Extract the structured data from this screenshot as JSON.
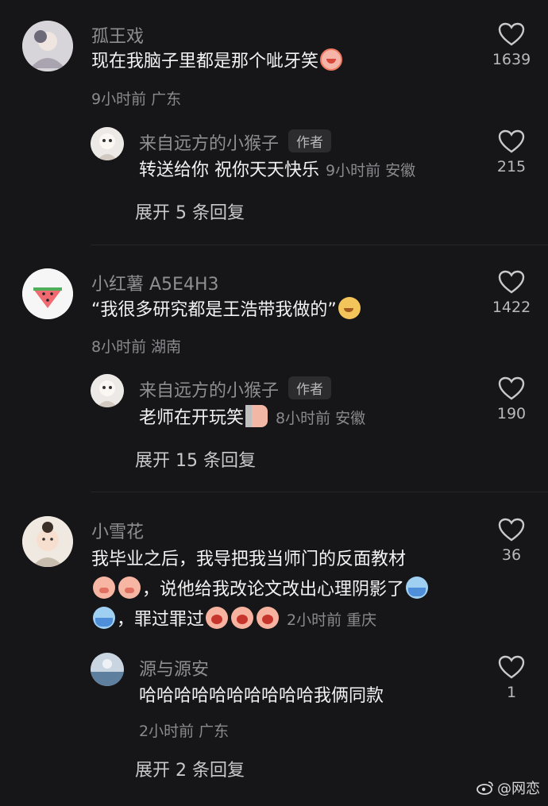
{
  "comments": [
    {
      "name": "孤王戏",
      "text_line1": "现在我脑子里都是那个呲牙笑",
      "time": "9小时前 广东",
      "likes": "1639",
      "reply": {
        "name": "来自远方的小猴子",
        "badge": "作者",
        "text": "转送给你 祝你天天快乐",
        "time": "9小时前 安徽",
        "likes": "215"
      },
      "expand": "展开 5 条回复"
    },
    {
      "name": "小红薯 A5E4H3",
      "text_line1": "“我很多研究都是王浩带我做的”",
      "time": "8小时前 湖南",
      "likes": "1422",
      "reply": {
        "name": "来自远方的小猴子",
        "badge": "作者",
        "text": "老师在开玩笑",
        "time": "8小时前 安徽",
        "likes": "190"
      },
      "expand": "展开 15 条回复"
    },
    {
      "name": "小雪花",
      "text_line1": "我毕业之后，我导把我当师门的反面教材",
      "text_line2": "，说他给我改论文改出心理阴影了",
      "text_line3": "，罪过罪过",
      "time": "2小时前 重庆",
      "likes": "36",
      "reply": {
        "name": "源与源安",
        "text": "哈哈哈哈哈哈哈哈哈哈我俩同款",
        "time": "2小时前 广东",
        "likes": "1"
      },
      "expand": "展开 2 条回复"
    }
  ],
  "watermark": "@网恋",
  "colors": {
    "background": "#161618",
    "secondary_text": "#8e8e93"
  }
}
